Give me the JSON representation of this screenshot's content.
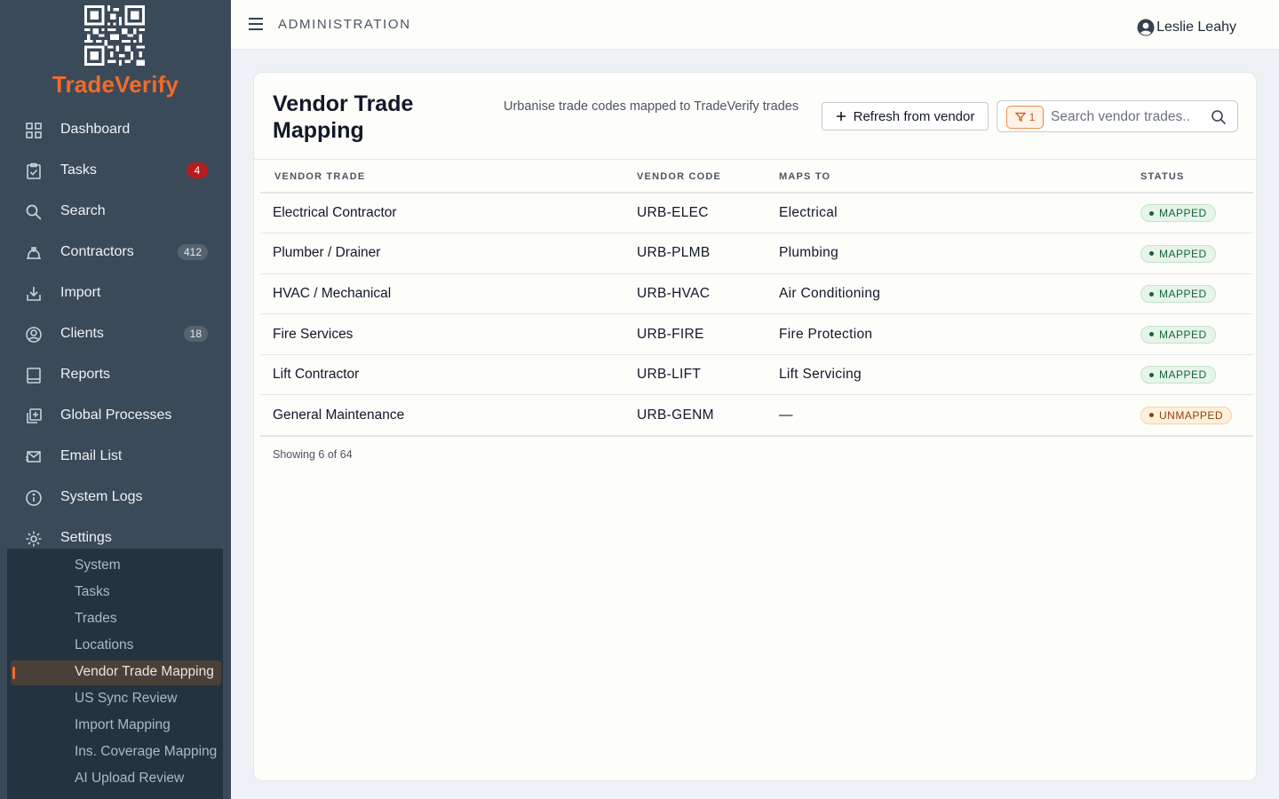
{
  "brand": {
    "name": "TradeVerify",
    "accent": "#f26b2a"
  },
  "topbar": {
    "title": "ADMINISTRATION",
    "user_name": "Leslie Leahy"
  },
  "sidebar": {
    "items": [
      {
        "label": "Dashboard",
        "icon": "dashboard-icon"
      },
      {
        "label": "Tasks",
        "icon": "clipboard-icon",
        "badge": "4"
      },
      {
        "label": "Search",
        "icon": "search-icon"
      },
      {
        "label": "Contractors",
        "icon": "hardhat-icon",
        "badge": "412"
      },
      {
        "label": "Import",
        "icon": "import-icon"
      },
      {
        "label": "Clients",
        "icon": "user-circle-icon",
        "badge": "18"
      },
      {
        "label": "Reports",
        "icon": "book-icon"
      },
      {
        "label": "Global Processes",
        "icon": "copy-plus-icon"
      },
      {
        "label": "Email List",
        "icon": "mail-icon"
      },
      {
        "label": "System Logs",
        "icon": "info-icon"
      },
      {
        "label": "Settings",
        "icon": "gear-icon"
      }
    ],
    "settings_sub": [
      "System",
      "Tasks",
      "Trades",
      "Locations",
      "Vendor Trade Mapping",
      "US Sync Review",
      "Import Mapping",
      "Ins. Coverage Mapping",
      "AI Upload Review"
    ],
    "active_sub": "Vendor Trade Mapping"
  },
  "page": {
    "title": "Vendor Trade Mapping",
    "subtitle": "Urbanise trade codes mapped to TradeVerify trades",
    "refresh_label": "Refresh from vendor",
    "filter_count": "1",
    "search_placeholder": "Search vendor trades..",
    "footer": "Showing 6 of 64"
  },
  "table": {
    "columns": [
      "VENDOR TRADE",
      "VENDOR CODE",
      "MAPS TO",
      "STATUS"
    ],
    "rows": [
      {
        "vendor_trade": "Electrical Contractor",
        "code": "URB-ELEC",
        "maps_to": "Electrical",
        "status": "MAPPED"
      },
      {
        "vendor_trade": "Plumber / Drainer",
        "code": "URB-PLMB",
        "maps_to": "Plumbing",
        "status": "MAPPED"
      },
      {
        "vendor_trade": "HVAC / Mechanical",
        "code": "URB-HVAC",
        "maps_to": "Air Conditioning",
        "status": "MAPPED"
      },
      {
        "vendor_trade": "Fire Services",
        "code": "URB-FIRE",
        "maps_to": "Fire Protection",
        "status": "MAPPED"
      },
      {
        "vendor_trade": "Lift Contractor",
        "code": "URB-LIFT",
        "maps_to": "Lift Servicing",
        "status": "MAPPED"
      },
      {
        "vendor_trade": "General Maintenance",
        "code": "URB-GENM",
        "maps_to": "—",
        "status": "UNMAPPED"
      }
    ]
  }
}
